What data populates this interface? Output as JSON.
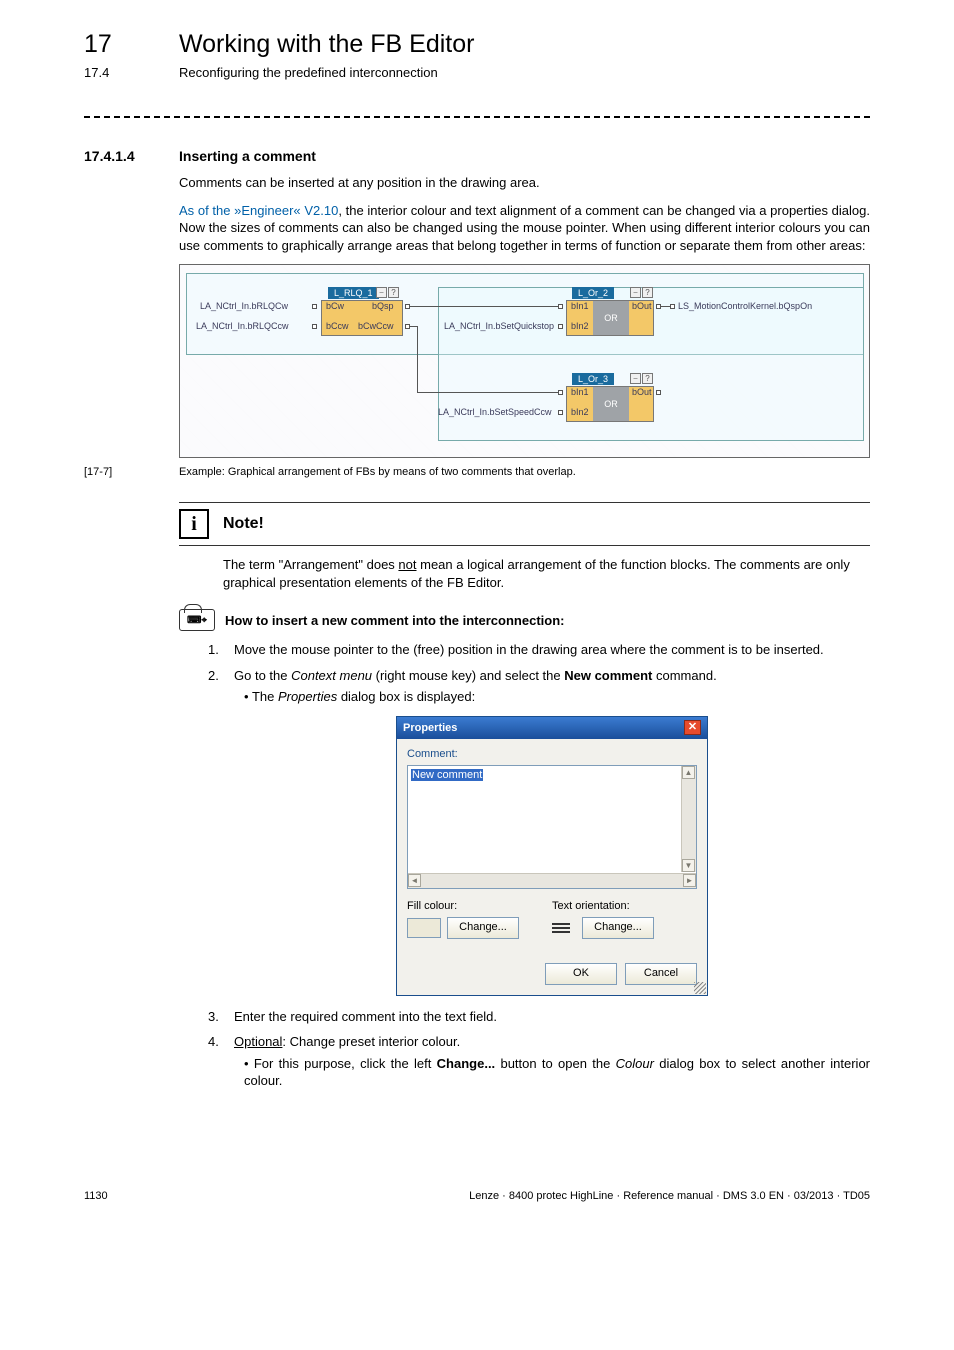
{
  "chapter": {
    "num": "17",
    "title": "Working with the FB Editor"
  },
  "subchapter": {
    "num": "17.4",
    "title": "Reconfiguring the predefined interconnection"
  },
  "section": {
    "num": "17.4.1.4",
    "title": "Inserting a comment"
  },
  "para1": "Comments can be inserted at any position in the drawing area.",
  "para2_lead": "As of the »Engineer« V2.10",
  "para2_rest": ", the interior colour and text alignment of a comment can be changed via a properties dialog. Now the sizes of comments can also be changed using the mouse pointer. When using different interior colours you can use comments to graphically arrange areas that belong together in terms of function or separate them from other areas:",
  "figure": {
    "fb1": {
      "title": "L_RLQ_1",
      "p1": "bCw",
      "p2": "bCcw",
      "o1": "bQsp",
      "o2": "bCwCcw",
      "in1": "LA_NCtrl_In.bRLQCw",
      "in2": "LA_NCtrl_In.bRLQCcw"
    },
    "or2": {
      "title": "L_Or_2",
      "op": "OR",
      "p1": "bIn1",
      "p2": "bIn2",
      "out": "bOut",
      "feed": "LA_NCtrl_In.bSetQuickstop",
      "dest": "LS_MotionControlKernel.bQspOn"
    },
    "or3": {
      "title": "L_Or_3",
      "op": "OR",
      "p1": "bIn1",
      "p2": "bIn2",
      "out": "bOut",
      "feed": "LA_NCtrl_In.bSetSpeedCcw"
    },
    "caption_num": "[17-7]",
    "caption_txt": "Example: Graphical arrangement of FBs by means of two comments that overlap."
  },
  "note": {
    "title": "Note!",
    "b1a": "The term \"Arrangement\" does ",
    "b1u": "not",
    "b1b": " mean a logical arrangement of the function blocks. The comments are only graphical presentation elements of the FB Editor."
  },
  "howto": "How to insert a new comment into the interconnection:",
  "steps": {
    "s1": "Move the mouse pointer to the (free) position in the drawing area where the comment is to be inserted.",
    "s2a": "Go to the ",
    "s2i1": "Context menu",
    "s2b": " (right mouse key) and select the ",
    "s2bold": "New comment",
    "s2c": " command.",
    "s2_sub_a": "The ",
    "s2_sub_i": "Properties",
    "s2_sub_b": " dialog box is displayed:",
    "s3": "Enter the required comment into the text field.",
    "s4_u": "Optional",
    "s4_rest": ": Change preset interior colour.",
    "s4_sub_a": "For this purpose, click the left ",
    "s4_sub_b": "Change...",
    "s4_sub_c": " button to open the ",
    "s4_sub_i": "Colour",
    "s4_sub_d": " dialog box to select another interior colour."
  },
  "dialog": {
    "title": "Properties",
    "label_comment": "Comment:",
    "textarea_sel": "New comment",
    "fill_label": "Fill colour:",
    "change_btn": "Change...",
    "orient_label": "Text orientation:",
    "ok": "OK",
    "cancel": "Cancel"
  },
  "footer": {
    "page": "1130",
    "info": "Lenze · 8400 protec HighLine · Reference manual · DMS 3.0 EN · 03/2013 · TD05"
  }
}
